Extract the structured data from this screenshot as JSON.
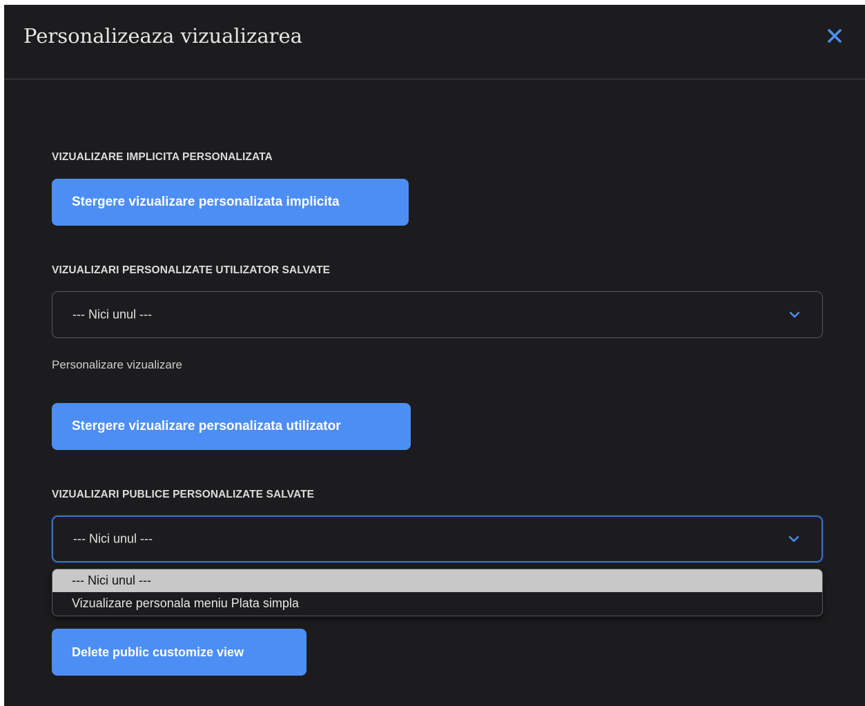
{
  "dialog": {
    "title": "Personalizeaza vizualizarea",
    "close_icon": "close-icon",
    "accent_color": "#4d8ef5"
  },
  "default_view": {
    "section_label": "VIZUALIZARE IMPLICITA PERSONALIZATA",
    "delete_button": "Stergere vizualizare personalizata implicita"
  },
  "user_views": {
    "section_label": "VIZUALIZARI PERSONALIZATE UTILIZATOR SALVATE",
    "selected_value": "--- Nici unul ---",
    "helper_text": "Personalizare vizualizare",
    "delete_button": "Stergere vizualizare personalizata utilizator"
  },
  "public_views": {
    "section_label": "VIZUALIZARI PUBLICE PERSONALIZATE SALVATE",
    "selected_value": "--- Nici unul ---",
    "options": [
      "--- Nici unul ---",
      "Vizualizare personala meniu Plata simpla"
    ],
    "delete_button": "Delete public customize view"
  }
}
